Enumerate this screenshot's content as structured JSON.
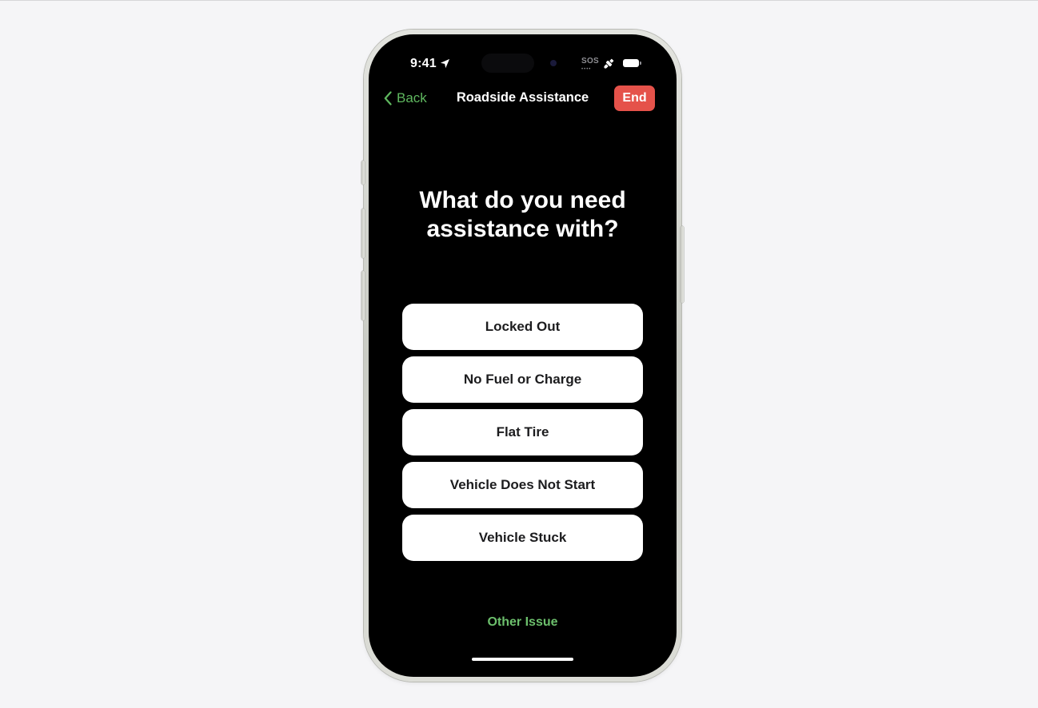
{
  "status_bar": {
    "time": "9:41",
    "location_icon": "location-arrow-icon",
    "sos_label": "SOS",
    "sos_dots": "••••",
    "satellite_icon": "satellite-icon",
    "battery_icon": "battery-icon"
  },
  "nav": {
    "back_label": "Back",
    "back_icon": "chevron-left-icon",
    "title": "Roadside Assistance",
    "end_label": "End"
  },
  "main": {
    "heading_line1": "What do you need",
    "heading_line2": "assistance with?",
    "options": [
      {
        "label": "Locked Out"
      },
      {
        "label": "No Fuel or Charge"
      },
      {
        "label": "Flat Tire"
      },
      {
        "label": "Vehicle Does Not Start"
      },
      {
        "label": "Vehicle Stuck"
      }
    ],
    "other_issue_label": "Other Issue"
  },
  "colors": {
    "accent_green": "#5fb85f",
    "end_red": "#e5524a",
    "screen_bg": "#000000",
    "page_bg": "#f5f5f7"
  }
}
